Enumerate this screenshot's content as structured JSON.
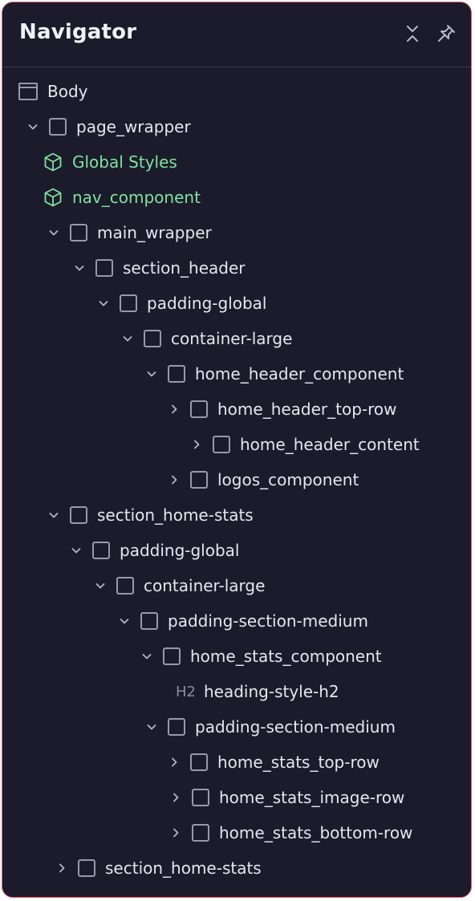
{
  "panel": {
    "title": "Navigator"
  },
  "icons": {
    "collapse": "collapse-icon",
    "pin": "pin-icon"
  },
  "tree": [
    {
      "label": "Body",
      "icon": "body-icon",
      "toggle": "none"
    },
    {
      "label": "page_wrapper",
      "icon": "element-icon",
      "toggle": "expanded"
    },
    {
      "label": "Global Styles",
      "icon": "component-icon",
      "toggle": "none",
      "accent": "#7ee3a0"
    },
    {
      "label": "nav_component",
      "icon": "component-icon",
      "toggle": "none",
      "accent": "#7ee3a0"
    },
    {
      "label": "main_wrapper",
      "icon": "element-icon",
      "toggle": "expanded"
    },
    {
      "label": "section_header",
      "icon": "element-icon",
      "toggle": "expanded"
    },
    {
      "label": "padding-global",
      "icon": "element-icon",
      "toggle": "expanded"
    },
    {
      "label": "container-large",
      "icon": "element-icon",
      "toggle": "expanded"
    },
    {
      "label": "home_header_component",
      "icon": "element-icon",
      "toggle": "expanded"
    },
    {
      "label": "home_header_top-row",
      "icon": "element-icon",
      "toggle": "collapsed"
    },
    {
      "label": "home_header_content",
      "icon": "element-icon",
      "toggle": "collapsed"
    },
    {
      "label": "logos_component",
      "icon": "element-icon",
      "toggle": "collapsed"
    },
    {
      "label": "section_home-stats",
      "icon": "element-icon",
      "toggle": "expanded"
    },
    {
      "label": "padding-global",
      "icon": "element-icon",
      "toggle": "expanded"
    },
    {
      "label": "container-large",
      "icon": "element-icon",
      "toggle": "expanded"
    },
    {
      "label": "padding-section-medium",
      "icon": "element-icon",
      "toggle": "expanded"
    },
    {
      "label": "home_stats_component",
      "icon": "element-icon",
      "toggle": "expanded"
    },
    {
      "label": "heading-style-h2",
      "icon": "heading-icon",
      "tag": "H2",
      "toggle": "none"
    },
    {
      "label": "padding-section-medium",
      "icon": "element-icon",
      "toggle": "expanded"
    },
    {
      "label": "home_stats_top-row",
      "icon": "element-icon",
      "toggle": "collapsed"
    },
    {
      "label": "home_stats_image-row",
      "icon": "element-icon",
      "toggle": "collapsed"
    },
    {
      "label": "home_stats_bottom-row",
      "icon": "element-icon",
      "toggle": "collapsed"
    },
    {
      "label": "section_home-stats",
      "icon": "element-icon",
      "toggle": "collapsed"
    }
  ],
  "colors": {
    "background": "#1c1b2b",
    "border": "#e8606c",
    "text": "#e6e6ee",
    "component": "#7ee3a0",
    "muted": "#9a99a8"
  }
}
